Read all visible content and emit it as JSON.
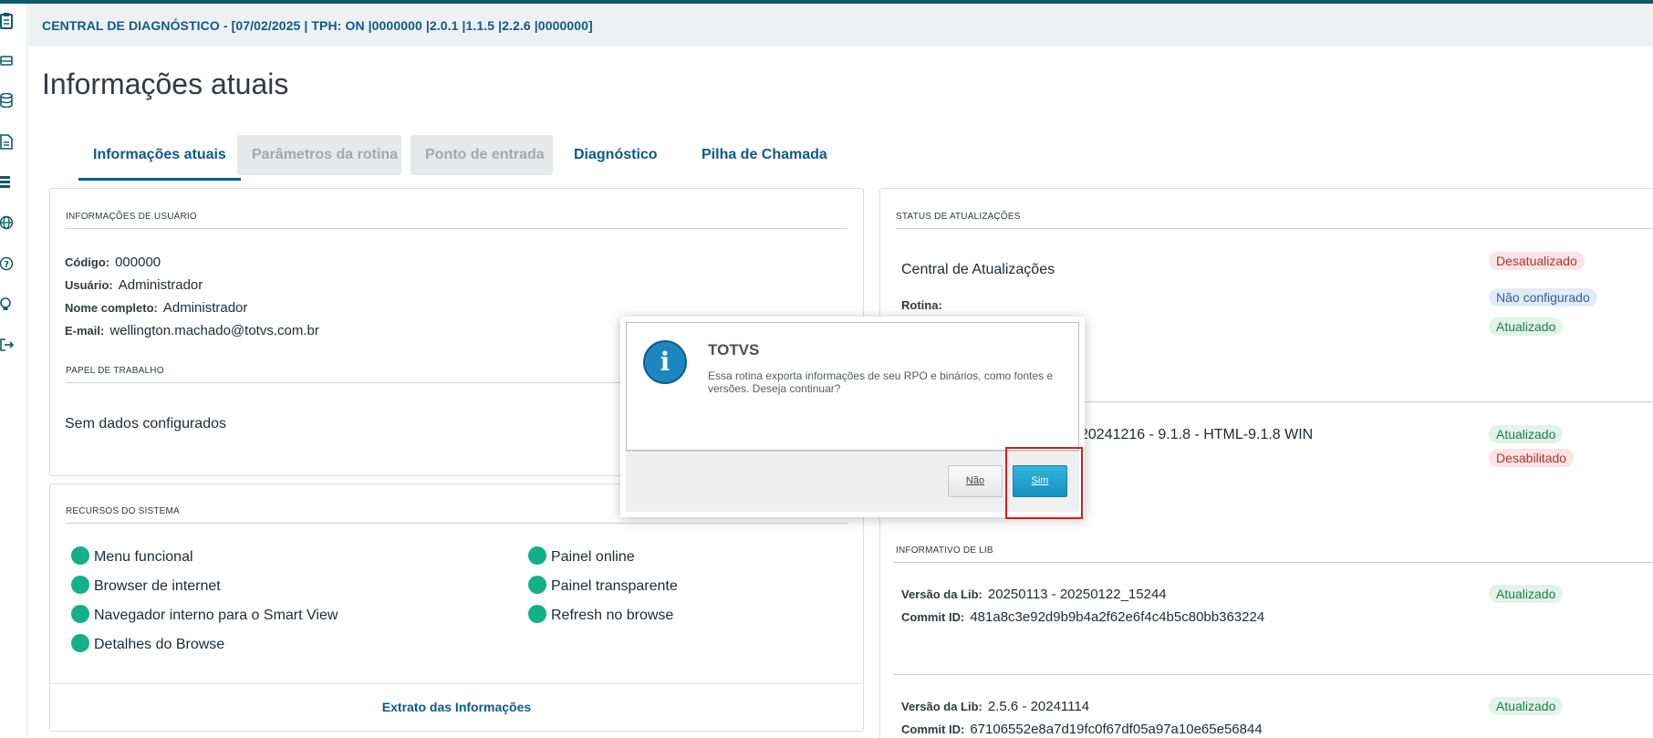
{
  "header": {
    "text": "CENTRAL DE DIAGNÓSTICO - [07/02/2025 | TPH: ON |0000000 |2.0.1 |1.1.5 |2.2.6 |0000000]"
  },
  "page": {
    "title": "Informações atuais"
  },
  "tabs": [
    {
      "label": "Informações atuais",
      "state": "active"
    },
    {
      "label": "Parâmetros da rotina",
      "state": "disabled"
    },
    {
      "label": "Ponto de entrada",
      "state": "disabled"
    },
    {
      "label": "Diagnóstico",
      "state": "normal"
    },
    {
      "label": "Pilha de Chamada",
      "state": "normal"
    }
  ],
  "user_info": {
    "title": "INFORMAÇÕES DE USUÁRIO",
    "codigo_label": "Código:",
    "codigo_value": "000000",
    "usuario_label": "Usuário:",
    "usuario_value": "Administrador",
    "nome_label": "Nome completo:",
    "nome_value": "Administrador",
    "email_label": "E-mail:",
    "email_value": "wellington.machado@totvs.com.br",
    "papel_title": "PAPEL DE TRABALHO",
    "papel_empty": "Sem dados configurados"
  },
  "recursos": {
    "title": "RECURSOS DO SISTEMA",
    "items": [
      "Menu funcional",
      "Browser de internet",
      "Navegador interno para o Smart View",
      "Detalhes do Browse",
      "Painel online",
      "Painel transparente",
      "Refresh no browse"
    ],
    "status_color": "#14b087",
    "footer_link": "Extrato das Informações"
  },
  "status": {
    "title": "STATUS DE ATUALIZAÇÕES",
    "central_label": "Central de Atualizações",
    "rotina_label": "Rotina:",
    "badges_top": [
      "Desatualizado",
      "Não configurado",
      "Atualizado"
    ],
    "version_text": "20241216 - 9.1.8 - HTML-9.1.8 WIN",
    "badges_mid": [
      "Atualizado",
      "Desabilitado"
    ]
  },
  "lib": {
    "title": "INFORMATIVO DE LIB",
    "entries": [
      {
        "versao_label": "Versão da Lib:",
        "versao_value": "20250113 - 20250122_15244",
        "commit_label": "Commit ID:",
        "commit_value": "481a8c3e92d9b9b4a2f62e6f4c4b5c80bb363224",
        "badge": "Atualizado"
      },
      {
        "versao_label": "Versão da Lib:",
        "versao_value": "2.5.6 - 20241114",
        "commit_label": "Commit ID:",
        "commit_value": "67106552e8a7d19fc0f67df05a97a10e65e56844",
        "badge": "Atualizado"
      }
    ]
  },
  "dialog": {
    "title": "TOTVS",
    "icon": "info-icon",
    "message": "Essa rotina exporta informações de seu RPO e binários, como fontes e versões. Deseja continuar?",
    "no_label": "Não",
    "yes_label": "Sim"
  },
  "sidebar_icons": [
    "clipboard-icon",
    "inbox-icon",
    "database-icon",
    "document-icon",
    "list-icon",
    "globe-icon",
    "help-icon",
    "lightbulb-icon",
    "logout-icon"
  ],
  "colors": {
    "accent": "#0c5a8a",
    "topbar": "#0c5a6b",
    "highlight": "#e3161b"
  }
}
